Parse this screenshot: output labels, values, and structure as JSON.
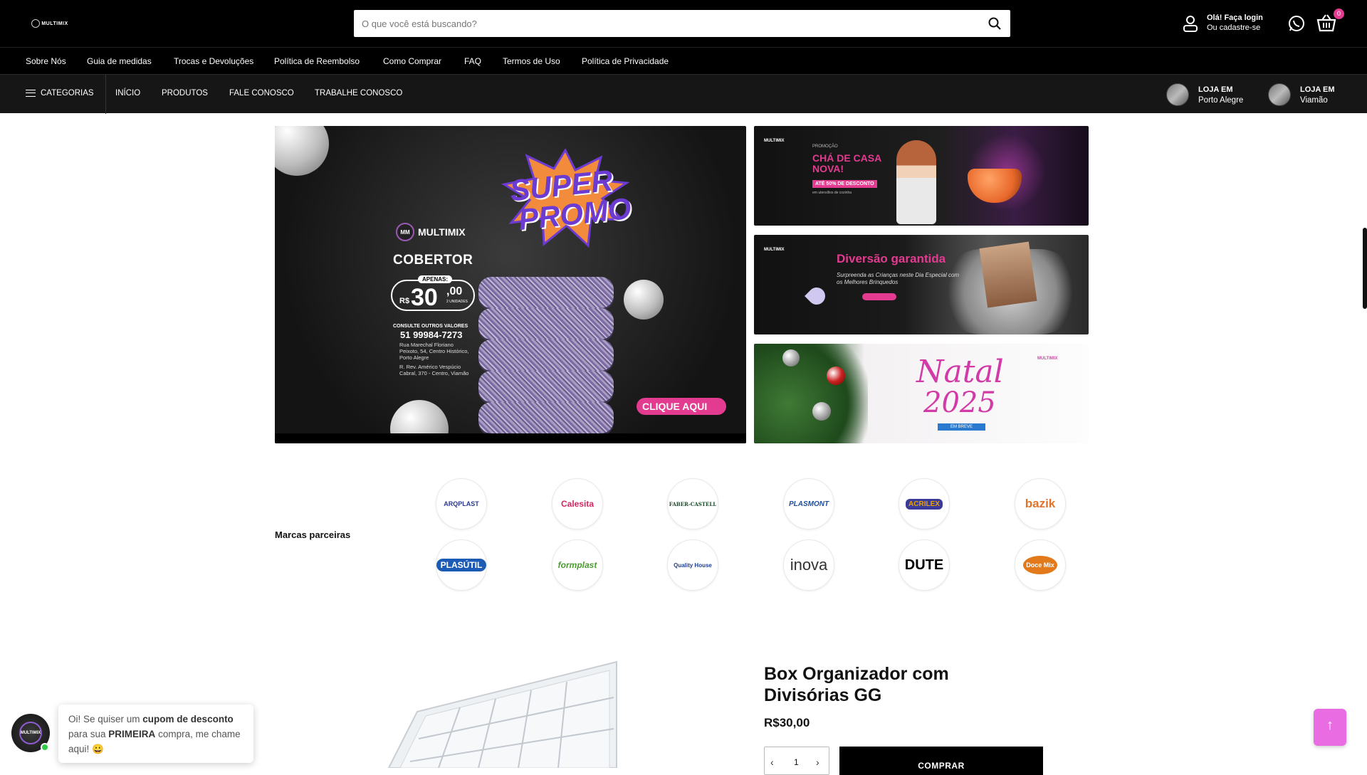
{
  "header": {
    "logo_text": "MULTIMIX",
    "search_placeholder": "O que você está buscando?",
    "login_line1": "Olá! Faça login",
    "login_line2": "Ou cadastre-se",
    "cart_count": "0"
  },
  "info_links": [
    "Sobre Nós",
    "Guia de medidas",
    "Trocas e Devoluções",
    "Política de Reembolso",
    "Como Comprar",
    "FAQ",
    "Termos de Uso",
    "Política de Privacidade"
  ],
  "nav": {
    "categories": "CATEGORIAS",
    "links": [
      "INÍCIO",
      "PRODUTOS",
      "FALE CONOSCO",
      "TRABALHE CONOSCO"
    ],
    "stores": [
      {
        "line1": "LOJA EM",
        "line2": "Porto Alegre"
      },
      {
        "line1": "LOJA EM",
        "line2": "Viamão"
      }
    ]
  },
  "hero": {
    "brand": "MULTIMIX",
    "title_top": "SUPER",
    "title_bottom": "PROMO",
    "product": "COBERTOR",
    "price_tag": "APENAS:",
    "currency": "R$",
    "price_int": "30",
    "price_cents": ",00",
    "price_units": "2 UNIDADES",
    "consult": "CONSULTE OUTROS VALORES",
    "phone": "51 99984-7273",
    "address1": "Rua Marechal Floriano Peixoto, 54, Centro Histórico, Porto Alegre",
    "address2": "R. Rev. Américo Vespúcio Cabral, 370 - Centro, Viamão",
    "cta": "CLIQUE AQUI"
  },
  "side_banners": {
    "b1": {
      "label": "PROMOÇÃO",
      "title": "CHÁ DE CASA NOVA!",
      "discount": "ATÉ 50% DE DESCONTO",
      "note": "em utensílios de cozinha"
    },
    "b2": {
      "title": "Diversão garantida",
      "subtitle": "Surpreenda as Crianças neste Dia Especial com os Melhores Brinquedos"
    },
    "b3": {
      "title": "Natal",
      "year": "2025",
      "tag": "EM BREVE"
    }
  },
  "brands": {
    "label": "Marcas parceiras",
    "row1": [
      {
        "name": "ARQPLAST",
        "color": "#2b3a8f"
      },
      {
        "name": "Calesita",
        "color": "#d6245f"
      },
      {
        "name": "FABER-CASTELL",
        "color": "#1b4d2b"
      },
      {
        "name": "PLASMONT",
        "color": "#1f4fa0"
      },
      {
        "name": "ACRILEX",
        "color": "#e9a300"
      },
      {
        "name": "bazik",
        "color": "#e2742a"
      }
    ],
    "row2": [
      {
        "name": "PLASÚTIL",
        "color": "#1c5bb5"
      },
      {
        "name": "formplast",
        "color": "#4a9b2e"
      },
      {
        "name": "Quality House",
        "color": "#1f3f8f"
      },
      {
        "name": "inova",
        "color": "#333333"
      },
      {
        "name": "DUTE",
        "color": "#000000"
      },
      {
        "name": "Doce Mix",
        "color": "#e27a1b"
      }
    ]
  },
  "product": {
    "title": "Box Organizador com Divisórias GG",
    "price": "R$30,00",
    "quantity": "1",
    "buy_label": "COMPRAR"
  },
  "chat": {
    "avatar_text": "MULTIMIX",
    "msg_before": "Oi! Se quiser um ",
    "msg_bold1": "cupom de desconto",
    "msg_mid": " para sua ",
    "msg_bold2": "PRIMEIRA",
    "msg_after": " compra, me chame aqui! 😀"
  },
  "colors": {
    "accent": "#e23b8f",
    "dark": "#000000",
    "back_to_top": "#e96ce3"
  }
}
